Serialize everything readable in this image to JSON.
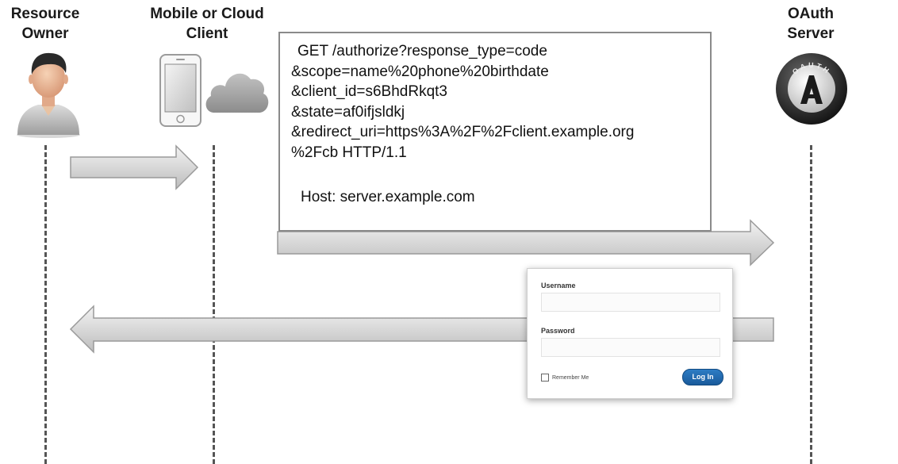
{
  "actors": {
    "resource_owner": {
      "line1": "Resource",
      "line2": "Owner"
    },
    "client": {
      "line1": "Mobile or Cloud",
      "line2": "Client"
    },
    "oauth_server": {
      "line1": "OAuth",
      "line2": "Server"
    }
  },
  "oauth_logo_text": "OAUTH",
  "request": {
    "lines": [
      "GET /authorize?response_type=code",
      "&scope=name%20phone%20birthdate",
      "&client_id=s6BhdRkqt3",
      "&state=af0ifjsldkj",
      "&redirect_uri=https%3A%2F%2Fclient.example.org",
      "%2Fcb HTTP/1.1"
    ],
    "host": "Host: server.example.com"
  },
  "login_form": {
    "username_label": "Username",
    "password_label": "Password",
    "remember_label": "Remember Me",
    "login_button": "Log In"
  }
}
